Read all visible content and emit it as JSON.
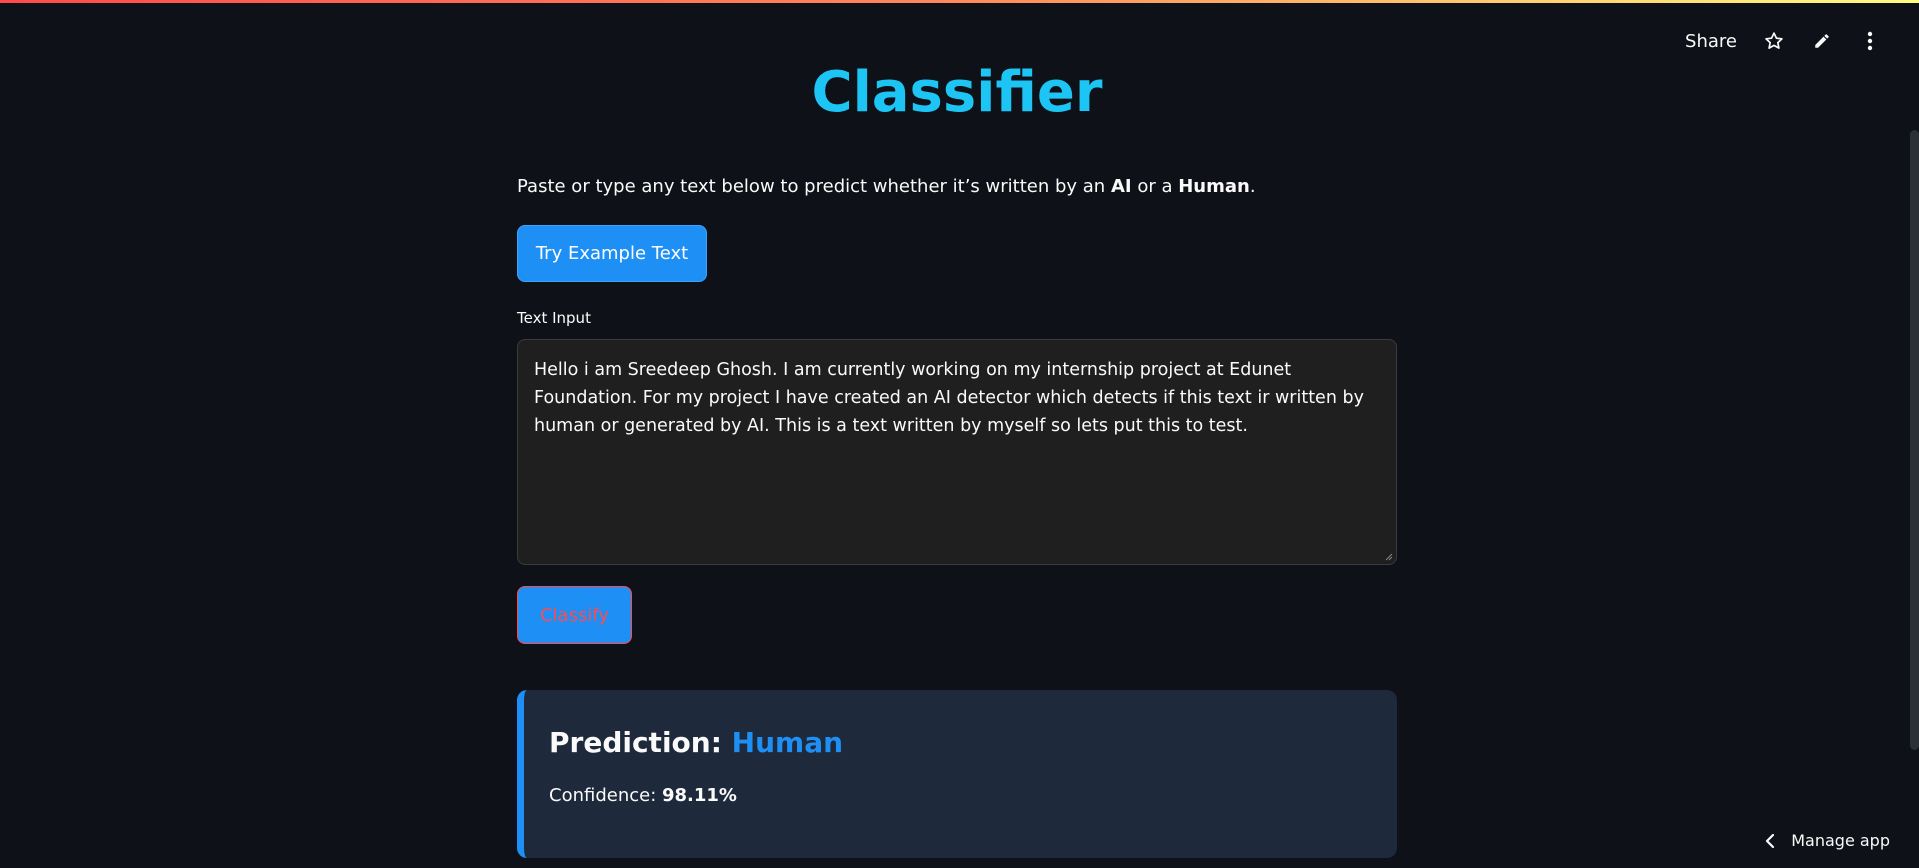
{
  "header": {
    "share_label": "Share",
    "icons": [
      "star-icon",
      "pencil-icon",
      "more-vertical-icon"
    ]
  },
  "app": {
    "title": "Classifier",
    "intro": {
      "prefix": "Paste or type any text below to predict whether it’s written by an ",
      "ai": "AI",
      "middle": " or a ",
      "human": "Human",
      "suffix": "."
    },
    "example_button": "Try Example Text",
    "text_input": {
      "label": "Text Input",
      "value": "Hello i am Sreedeep Ghosh. I am currently working on my internship project at Edunet Foundation. For my project I have created an AI detector which detects if this text ir written by human or generated by AI. This is a text written by myself so lets put this to test."
    },
    "classify_button": "Classify",
    "result": {
      "prediction_label": "Prediction: ",
      "prediction_value": "Human",
      "confidence_label": "Confidence: ",
      "confidence_value": "98.11%"
    }
  },
  "footer": {
    "manage_app_label": "Manage app"
  },
  "colors": {
    "background": "#0e1117",
    "title": "#1dc5f5",
    "primary_button": "#1e90f5",
    "classify_text": "#ff4b4b",
    "card_background": "#1e2a3b"
  }
}
